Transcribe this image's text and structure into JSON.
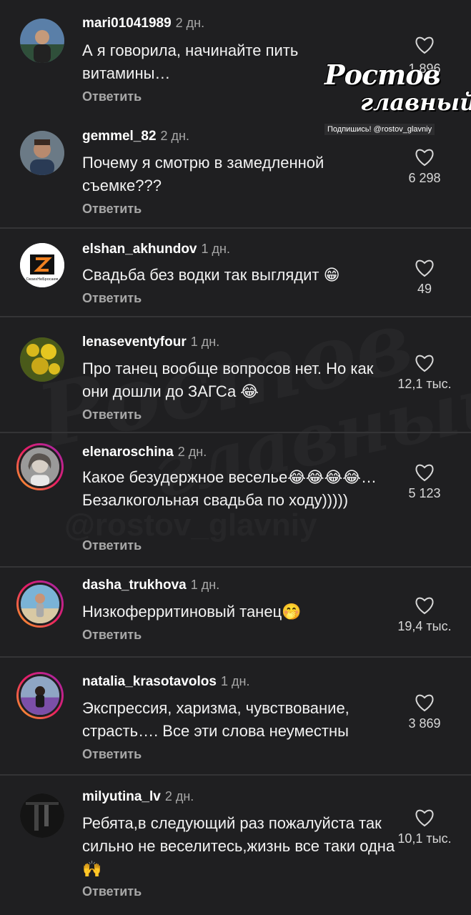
{
  "watermark": {
    "brand_line1": "Ростов",
    "brand_line2": "главный",
    "subscribe": "Подпишись! @rostov_glavniy",
    "ghost_handle": "@rostov_glavniy"
  },
  "comments": [
    {
      "username": "mari01041989",
      "time": "2 дн.",
      "text": "А я говорила, начинайте пить витамины…",
      "reply_label": "Ответить",
      "likes": "1 896"
    },
    {
      "username": "gemmel_82",
      "time": "2 дн.",
      "text": "Почему я смотрю в замедленной съемке???",
      "reply_label": "Ответить",
      "likes": "6 298"
    },
    {
      "username": "elshan_akhundov",
      "time": "1 дн.",
      "text": "Свадьба без водки так выглядит 😁",
      "reply_label": "Ответить",
      "likes": "49",
      "avatar_caption": "СвоихНеБросаем"
    },
    {
      "username": "lenaseventyfour",
      "time": "1 дн.",
      "text": "Про танец вообще вопросов нет. Но как они дошли до ЗАГСа 😂",
      "reply_label": "Ответить",
      "likes": "12,1 тыс."
    },
    {
      "username": "elenaroschina",
      "time": "2 дн.",
      "text": "Какое безудержное веселье😂😂😂😂… Безалкогольная свадьба по ходу)))))",
      "reply_label": "Ответить",
      "likes": "5 123"
    },
    {
      "username": "dasha_trukhova",
      "time": "1 дн.",
      "text": "Низкоферритиновый танец🤭",
      "reply_label": "Ответить",
      "likes": "19,4 тыс."
    },
    {
      "username": "natalia_krasotavolos",
      "time": "1 дн.",
      "text": "Экспрессия, харизма, чувствование, страсть…. Все эти слова неуместны",
      "reply_label": "Ответить",
      "likes": "3 869"
    },
    {
      "username": "milyutina_lv",
      "time": "2 дн.",
      "text": "Ребята,в следующий раз пожалуйста так сильно не веселитесь,жизнь все таки одна 🙌",
      "reply_label": "Ответить",
      "likes": "10,1 тыс."
    }
  ]
}
